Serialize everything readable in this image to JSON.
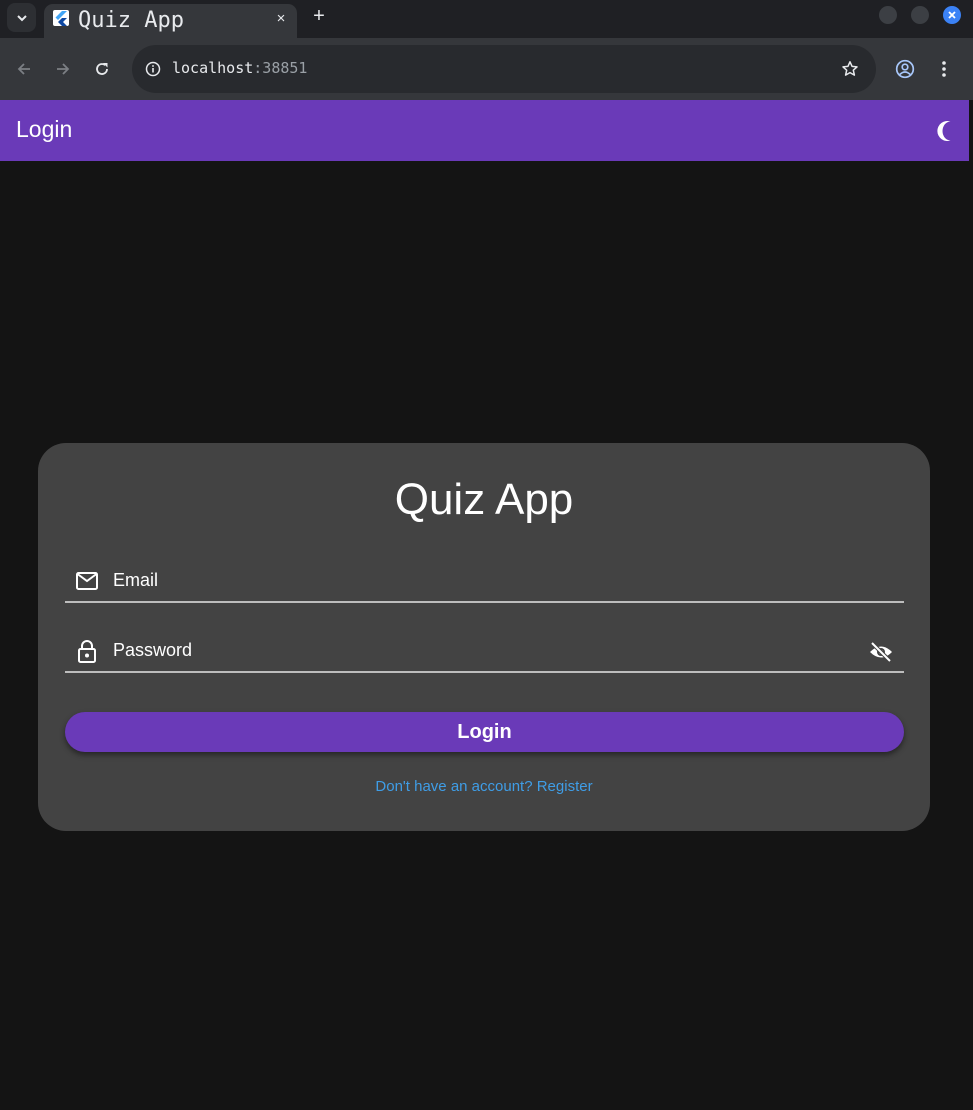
{
  "browser": {
    "tab_title": "Quiz App",
    "tab_close": "×",
    "new_tab": "+",
    "url_host": "localhost",
    "url_port": ":38851"
  },
  "appbar": {
    "title": "Login",
    "theme_icon": "moon-icon"
  },
  "card": {
    "title": "Quiz App",
    "email": {
      "label": "Email",
      "icon": "mail-icon"
    },
    "password": {
      "label": "Password",
      "icon": "lock-icon",
      "toggle_icon": "eye-off-icon"
    },
    "login_label": "Login",
    "register_link": "Don't have an account? Register"
  },
  "colors": {
    "primary": "#6a3ab8",
    "background": "#141414",
    "card": "#434343",
    "link": "#3f9de6"
  }
}
